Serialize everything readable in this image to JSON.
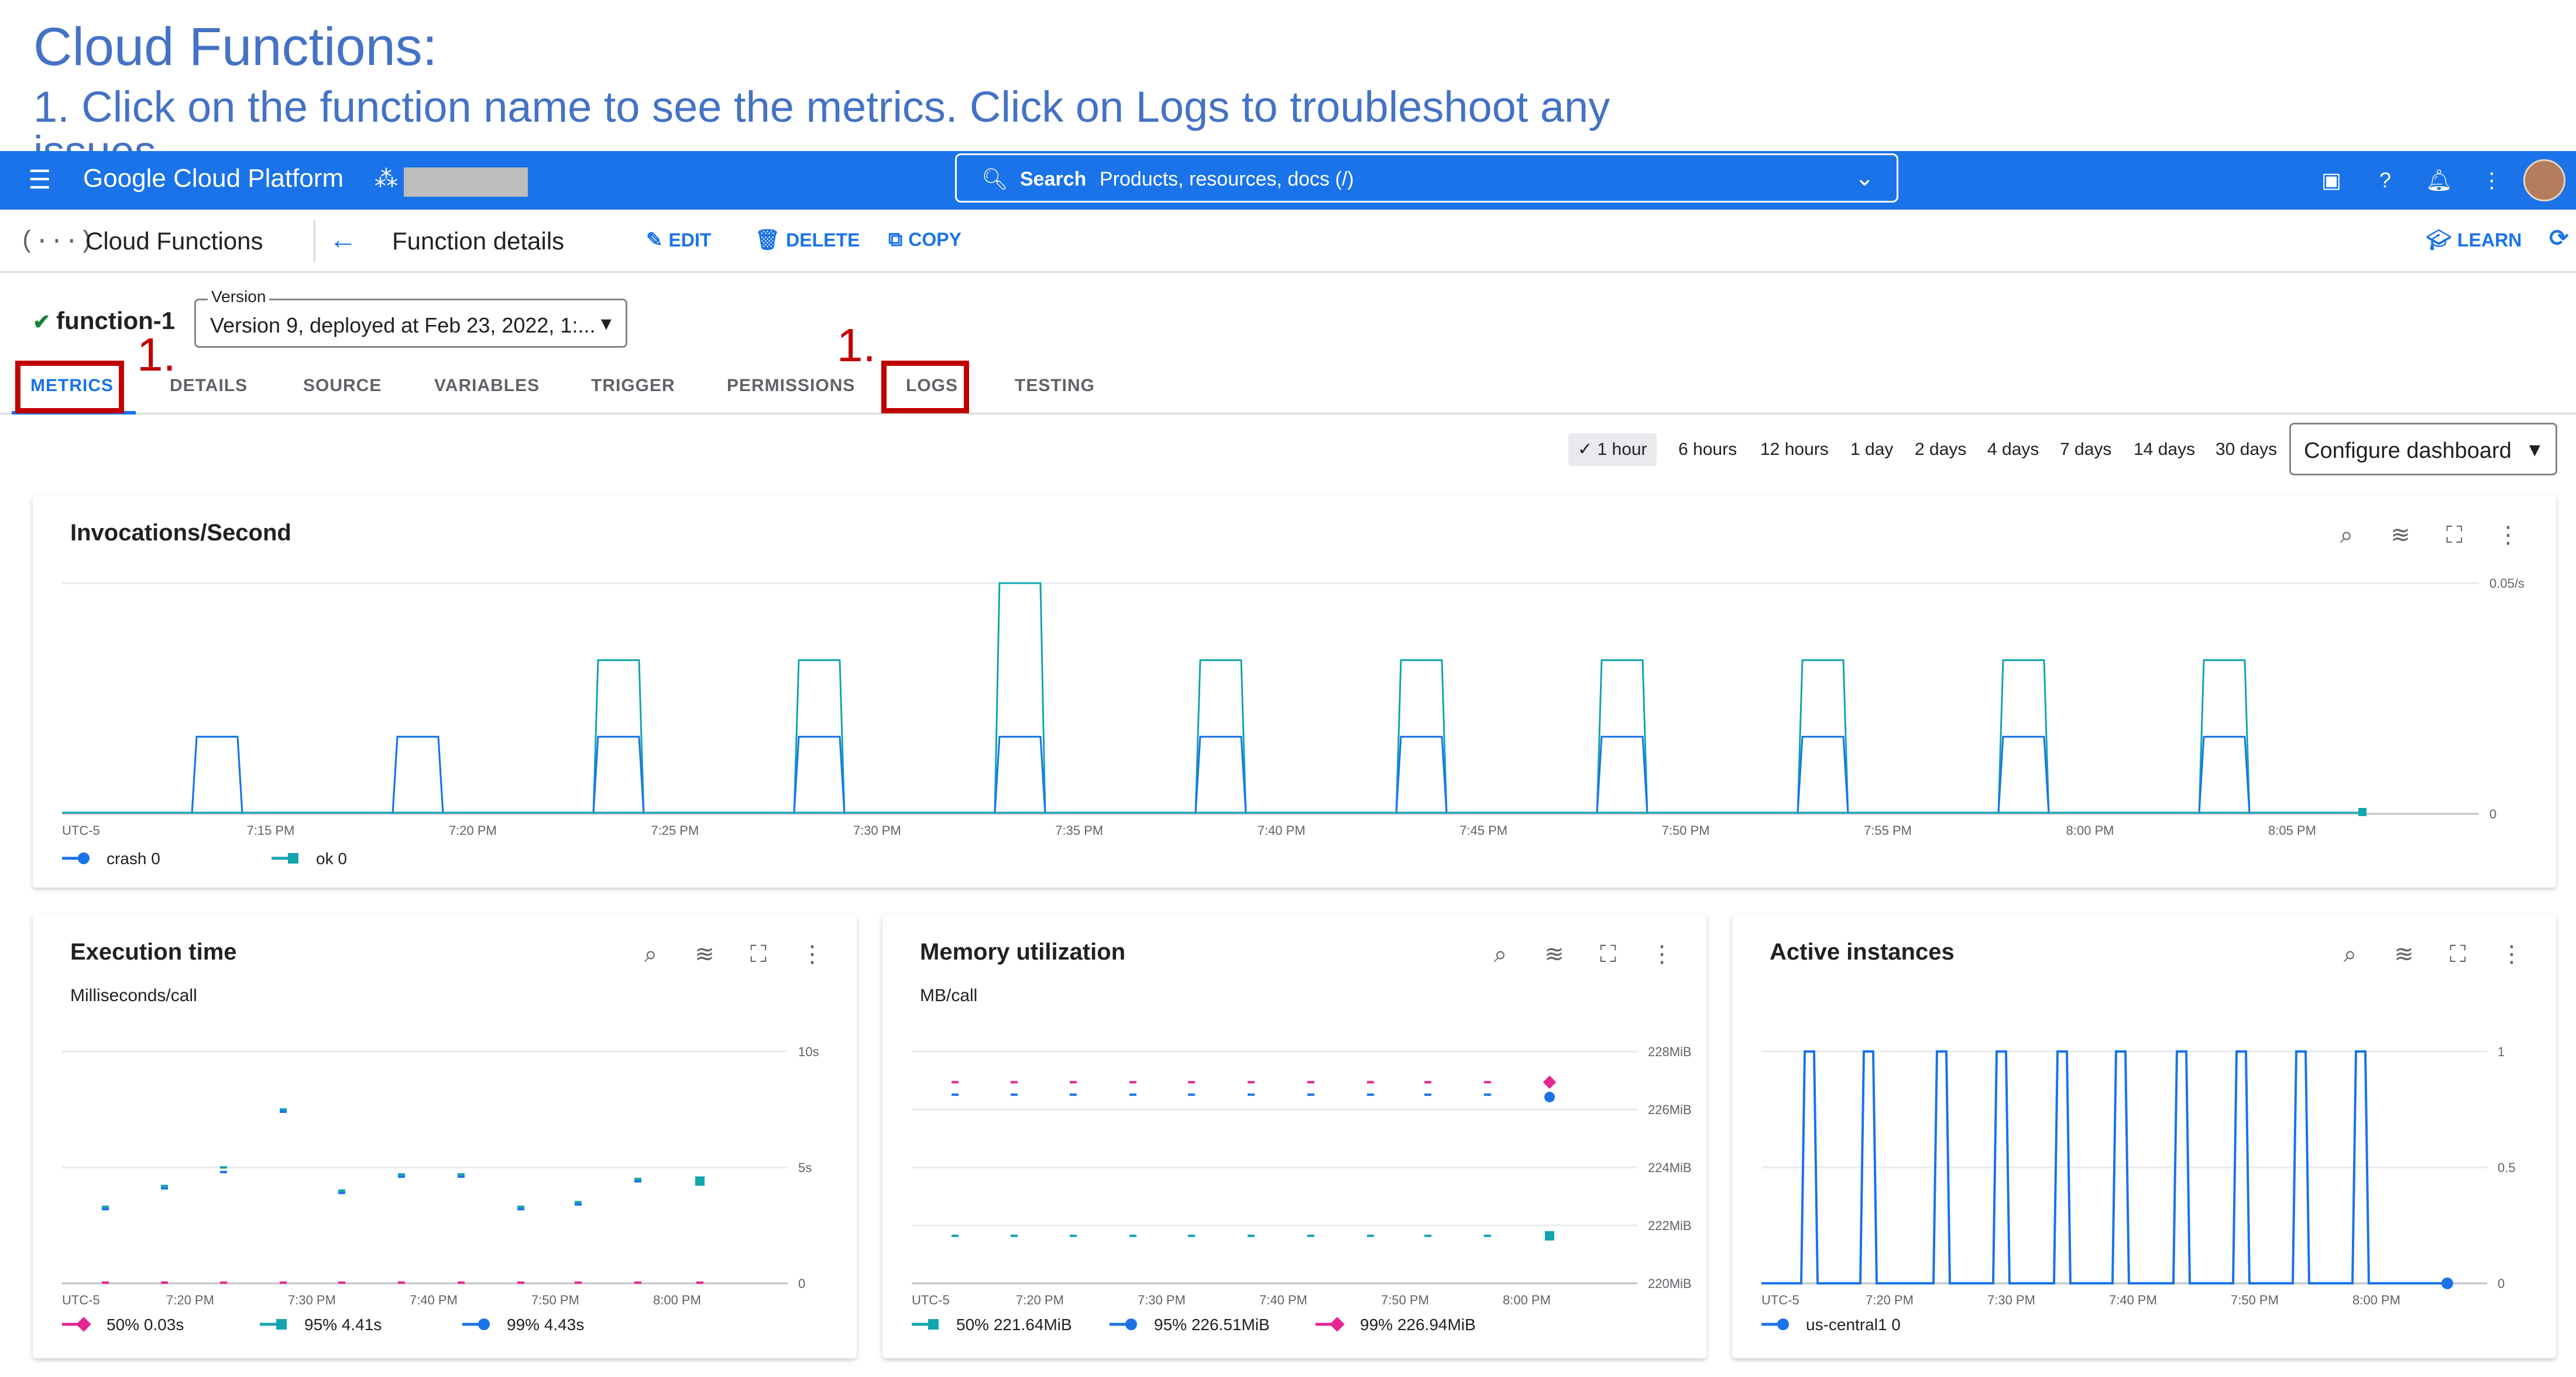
{
  "slide": {
    "title": "Cloud Functions:",
    "subtitle": "1. Click on the function name to see the metrics. Click on Logs to troubleshoot any",
    "subtitle2": "issues"
  },
  "topbar": {
    "brand": "Google Cloud Platform",
    "search_label": "Search",
    "search_hint": "Products, resources, docs (/)"
  },
  "subbar": {
    "product": "Cloud Functions",
    "page": "Function details",
    "edit": "EDIT",
    "delete": "DELETE",
    "copy": "COPY",
    "learn": "LEARN"
  },
  "function": {
    "name": "function-1",
    "version_label": "Version",
    "version_value": "Version 9, deployed at Feb 23, 2022, 1:..."
  },
  "tabs": [
    "METRICS",
    "DETAILS",
    "SOURCE",
    "VARIABLES",
    "TRIGGER",
    "PERMISSIONS",
    "LOGS",
    "TESTING"
  ],
  "annotations": {
    "metrics": "1.",
    "logs": "1."
  },
  "ranges": [
    "1 hour",
    "6 hours",
    "12 hours",
    "1 day",
    "2 days",
    "4 days",
    "7 days",
    "14 days",
    "30 days"
  ],
  "configure_label": "Configure dashboard",
  "colors": {
    "accent": "#1a73e8",
    "teal": "#12a4af",
    "blue": "#1a73e8",
    "pink": "#e52592",
    "annotation": "#c00000"
  },
  "chart_data": [
    {
      "type": "line",
      "title": "Invocations/Second",
      "x_ticks": [
        "UTC-5",
        "7:15 PM",
        "7:20 PM",
        "7:25 PM",
        "7:30 PM",
        "7:35 PM",
        "7:40 PM",
        "7:45 PM",
        "7:50 PM",
        "7:55 PM",
        "8:00 PM",
        "8:05 PM"
      ],
      "y_ticks": [
        "0.05/s",
        "0"
      ],
      "ylim": [
        0,
        0.05
      ],
      "pulses": [
        {
          "time": "7:13 PM",
          "crash": 0.0167,
          "ok": 0.0167
        },
        {
          "time": "7:18 PM",
          "crash": 0.0167,
          "ok": 0.0167
        },
        {
          "time": "7:23 PM",
          "crash": 0.0167,
          "ok": 0.0333
        },
        {
          "time": "7:28 PM",
          "crash": 0.0167,
          "ok": 0.0333
        },
        {
          "time": "7:33 PM",
          "crash": 0.0167,
          "ok": 0.05
        },
        {
          "time": "7:38 PM",
          "crash": 0.0167,
          "ok": 0.0333
        },
        {
          "time": "7:43 PM",
          "crash": 0.0167,
          "ok": 0.0333
        },
        {
          "time": "7:48 PM",
          "crash": 0.0167,
          "ok": 0.0333
        },
        {
          "time": "7:53 PM",
          "crash": 0.0167,
          "ok": 0.0333
        },
        {
          "time": "7:58 PM",
          "crash": 0.0167,
          "ok": 0.0333
        },
        {
          "time": "8:03 PM",
          "crash": 0.0167,
          "ok": 0.0333
        }
      ],
      "series": [
        {
          "name": "crash",
          "color": "#1a73e8",
          "legend": "crash 0"
        },
        {
          "name": "ok",
          "color": "#12a4af",
          "legend": "ok 0"
        }
      ]
    },
    {
      "type": "scatter",
      "title": "Execution time",
      "unit": "Milliseconds/call",
      "x_ticks": [
        "UTC-5",
        "7:20 PM",
        "7:30 PM",
        "7:40 PM",
        "7:50 PM",
        "8:00 PM"
      ],
      "y_ticks": [
        "10s",
        "5s",
        "0"
      ],
      "ylim": [
        0,
        10
      ],
      "series": [
        {
          "name": "50%",
          "legend": "50% 0.03s",
          "color": "#e52592",
          "values": [
            0.03,
            0.03,
            0.03,
            0.03,
            0.03,
            0.03,
            0.03,
            0.03,
            0.03,
            0.03,
            0.03,
            0.03
          ]
        },
        {
          "name": "95%",
          "legend": "95% 4.41s",
          "color": "#12a4af",
          "values": [
            3.3,
            4.2,
            5.0,
            7.5,
            4.0,
            4.7,
            4.7,
            3.3,
            3.5,
            4.5,
            4.41
          ]
        },
        {
          "name": "99%",
          "legend": "99% 4.43s",
          "color": "#1a73e8",
          "values": [
            3.3,
            4.2,
            4.9,
            7.5,
            4.0,
            4.7,
            4.7,
            3.3,
            3.5,
            4.5,
            4.43
          ]
        }
      ]
    },
    {
      "type": "scatter",
      "title": "Memory utilization",
      "unit": "MB/call",
      "x_ticks": [
        "UTC-5",
        "7:20 PM",
        "7:30 PM",
        "7:40 PM",
        "7:50 PM",
        "8:00 PM"
      ],
      "y_ticks": [
        "228MiB",
        "226MiB",
        "224MiB",
        "222MiB",
        "220MiB"
      ],
      "ylim": [
        220,
        228
      ],
      "series": [
        {
          "name": "50%",
          "legend": "50% 221.64MiB",
          "color": "#12a4af",
          "values": [
            221.64,
            221.64,
            221.64,
            221.64,
            221.64,
            221.64,
            221.64,
            221.64,
            221.64,
            221.64,
            221.64
          ]
        },
        {
          "name": "95%",
          "legend": "95% 226.51MiB",
          "color": "#1a73e8",
          "values": [
            226.51,
            226.51,
            226.51,
            226.51,
            226.51,
            226.51,
            226.51,
            226.51,
            226.51,
            226.51,
            226.51
          ]
        },
        {
          "name": "99%",
          "legend": "99% 226.94MiB",
          "color": "#e52592",
          "values": [
            226.94,
            226.94,
            226.94,
            226.94,
            226.94,
            226.94,
            226.94,
            226.94,
            226.94,
            226.94,
            226.94
          ]
        }
      ]
    },
    {
      "type": "line",
      "title": "Active instances",
      "x_ticks": [
        "UTC-5",
        "7:20 PM",
        "7:30 PM",
        "7:40 PM",
        "7:50 PM",
        "8:00 PM"
      ],
      "y_ticks": [
        "1",
        "0.5",
        "0"
      ],
      "ylim": [
        0,
        1
      ],
      "pulses": [
        1,
        1,
        1,
        1,
        1,
        1,
        1,
        1,
        1,
        1,
        1
      ],
      "series": [
        {
          "name": "us-central1",
          "legend": "us-central1 0",
          "color": "#1a73e8"
        }
      ]
    }
  ]
}
